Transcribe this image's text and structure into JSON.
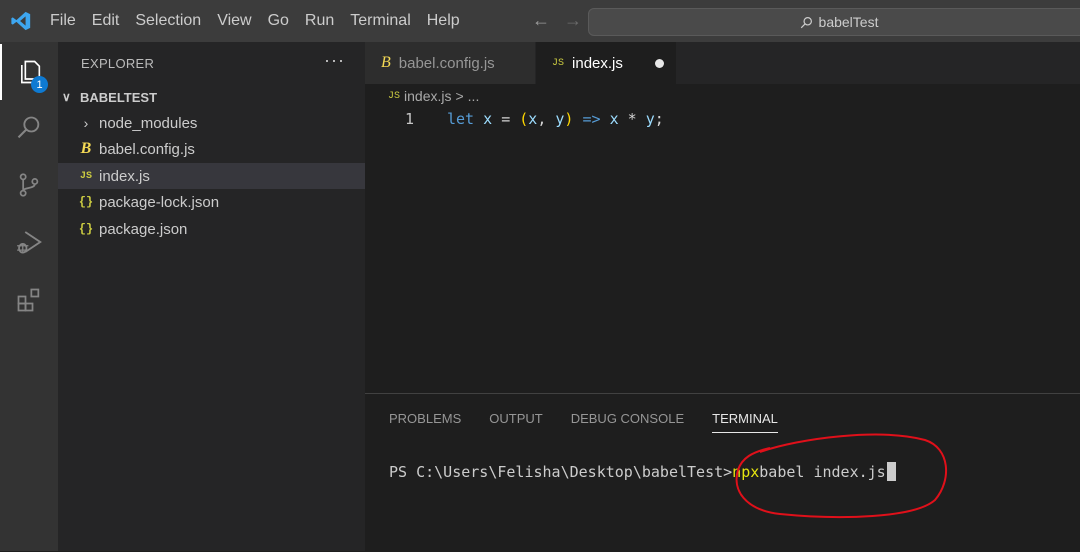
{
  "menu": [
    "File",
    "Edit",
    "Selection",
    "View",
    "Go",
    "Run",
    "Terminal",
    "Help"
  ],
  "search": {
    "text": "babelTest"
  },
  "activity": {
    "explorer_badge": "1"
  },
  "sidebar": {
    "header": "EXPLORER",
    "more": "···",
    "folder": "BABELTEST",
    "items": [
      {
        "label": "node_modules",
        "icon": "chevron-right-icon"
      },
      {
        "label": "babel.config.js",
        "icon": "babel-icon"
      },
      {
        "label": "index.js",
        "icon": "js-icon",
        "selected": true
      },
      {
        "label": "package-lock.json",
        "icon": "json-icon"
      },
      {
        "label": "package.json",
        "icon": "json-icon"
      }
    ],
    "js_glyph": "JS",
    "json_glyph": "{}",
    "babel_glyph": "B"
  },
  "tabs": [
    {
      "label": "babel.config.js",
      "active": false
    },
    {
      "label": "index.js",
      "active": true,
      "modified": true
    }
  ],
  "breadcrumb": {
    "file": "index.js",
    "sep": ">",
    "rest": "..."
  },
  "editor": {
    "line_number": "1",
    "tokens": {
      "kw": "let",
      "name": "x",
      "eq": "=",
      "open": "(",
      "a": "x",
      "comma": ",",
      "b": "y",
      "close": ")",
      "arrow": "=>",
      "x2": "x",
      "mul": "*",
      "y2": "y",
      "semi": ";"
    }
  },
  "panel": {
    "tabs": [
      "PROBLEMS",
      "OUTPUT",
      "DEBUG CONSOLE",
      "TERMINAL"
    ],
    "active_tab": "TERMINAL",
    "prompt": "PS C:\\Users\\Felisha\\Desktop\\babelTest>",
    "cmd_npx": "npx",
    "cmd_rest": "babel index.js"
  },
  "colors": {
    "accent": "#0e7ad2",
    "annotation": "#e0101a"
  }
}
